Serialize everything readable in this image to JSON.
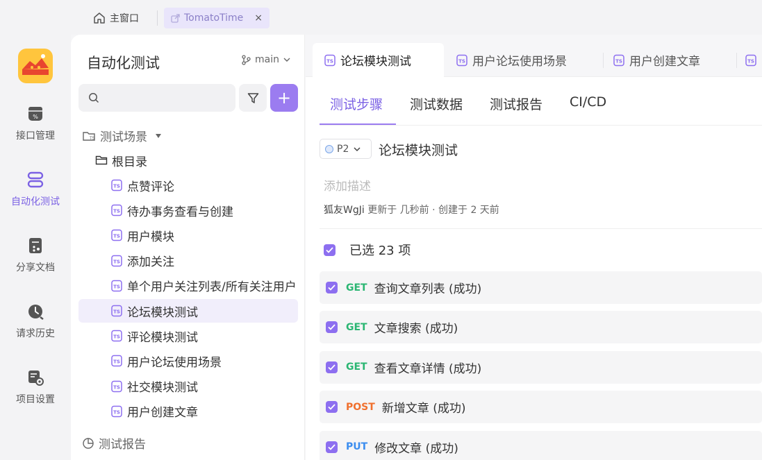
{
  "window_tabs": {
    "home_label": "主窗口",
    "active_label": "TomatoTime",
    "close_glyph": "×"
  },
  "rail": {
    "items": [
      {
        "label": "接口管理",
        "icon": "api-icon"
      },
      {
        "label": "自动化测试",
        "icon": "automation-icon"
      },
      {
        "label": "分享文档",
        "icon": "share-doc-icon"
      },
      {
        "label": "请求历史",
        "icon": "history-icon"
      },
      {
        "label": "项目设置",
        "icon": "settings-icon"
      }
    ],
    "active_color": "#7b61e4"
  },
  "tree": {
    "title": "自动化测试",
    "branch": "main",
    "search_placeholder": "",
    "add_label": "+",
    "section_scenarios": "测试场景",
    "root_folder": "根目录",
    "items": [
      "点赞评论",
      "待办事务查看与创建",
      "用户模块",
      "添加关注",
      "单个用户关注列表/所有关注用户",
      "论坛模块测试",
      "评论模块测试",
      "用户论坛使用场景",
      "社交模块测试",
      "用户创建文章"
    ],
    "selected_index": 5,
    "section_reports": "测试报告"
  },
  "main": {
    "doc_tabs": [
      "论坛模块测试",
      "用户论坛使用场景",
      "用户创建文章"
    ],
    "sub_tabs": [
      "测试步骤",
      "测试数据",
      "测试报告",
      "CI/CD"
    ],
    "priority": "P2",
    "case_title": "论坛模块测试",
    "description_placeholder": "添加描述",
    "meta": {
      "author": "狐友WgJi",
      "text": "更新于 几秒前 · 创建于 2 天前"
    },
    "selected_count": "已选 23 项",
    "steps": [
      {
        "method": "GET",
        "name": "查询文章列表 (成功)"
      },
      {
        "method": "GET",
        "name": "文章搜索 (成功)"
      },
      {
        "method": "GET",
        "name": "查看文章详情 (成功)"
      },
      {
        "method": "POST",
        "name": "新增文章 (成功)"
      },
      {
        "method": "PUT",
        "name": "修改文章 (成功)"
      }
    ],
    "method_colors": {
      "GET": "#2bb673",
      "POST": "#f0702e",
      "PUT": "#3b8def"
    },
    "accent": "#9b7cf0"
  }
}
